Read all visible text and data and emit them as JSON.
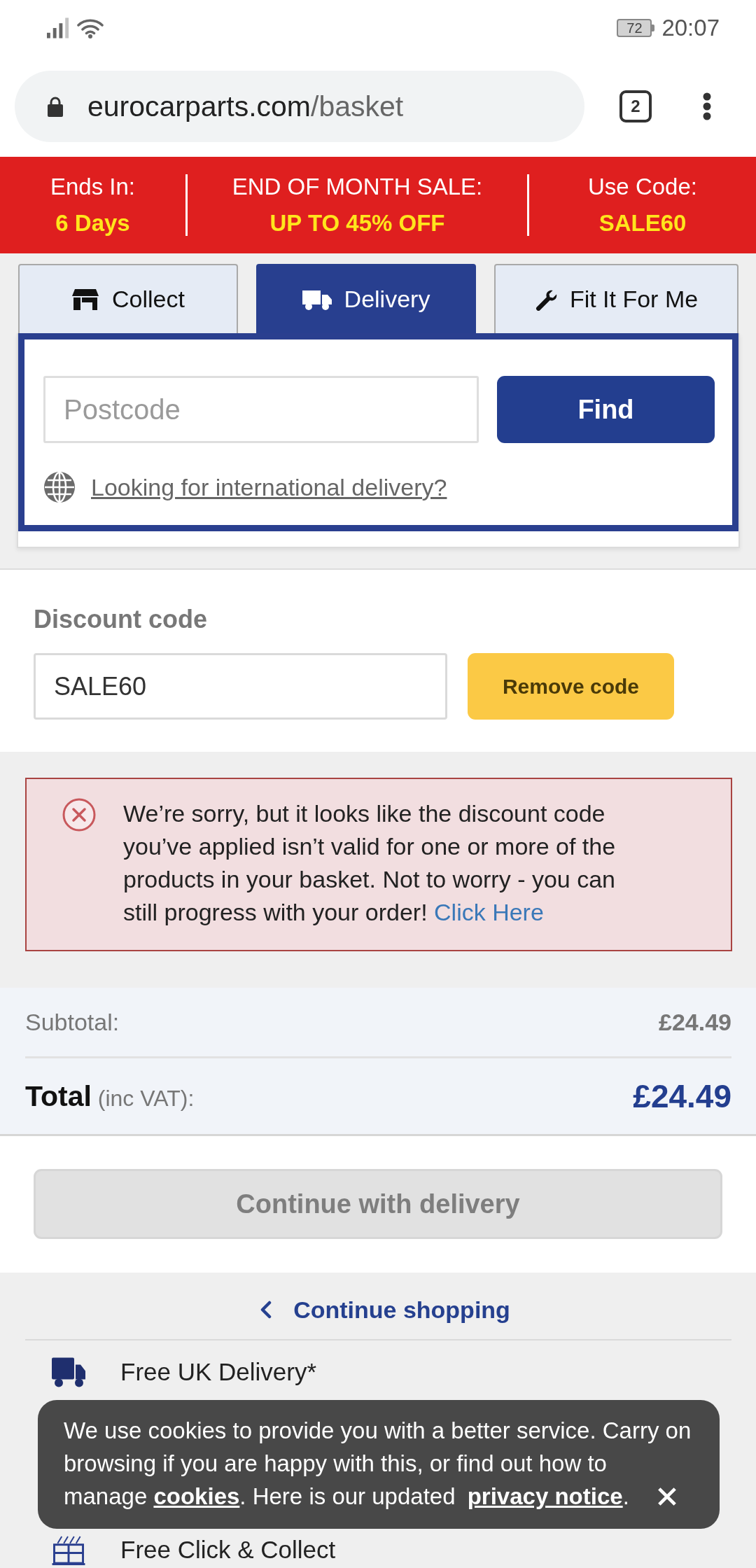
{
  "status_bar": {
    "battery": "72",
    "time": "20:07"
  },
  "address_bar": {
    "domain": "eurocarparts.com",
    "path": "/basket",
    "tab_count": "2"
  },
  "promo_banner": [
    {
      "label": "Ends In:",
      "value": "6 Days"
    },
    {
      "label": "END OF MONTH SALE:",
      "value": "UP TO 45% OFF"
    },
    {
      "label": "Use Code:",
      "value": "SALE60"
    }
  ],
  "delivery_tabs": [
    {
      "kind": "collect",
      "label": "Collect",
      "selected": false
    },
    {
      "kind": "delivery",
      "label": "Delivery",
      "selected": true
    },
    {
      "kind": "fitting",
      "label": "Fit It For Me",
      "selected": false
    }
  ],
  "postcode_search": {
    "placeholder": "Postcode",
    "button": "Find",
    "international_link": "Looking for international delivery?"
  },
  "discount": {
    "label": "Discount code",
    "value": "SALE60",
    "button": "Remove code"
  },
  "error_alert": {
    "message": "We’re sorry, but it looks like the discount code you’ve applied isn’t valid for one or more of the products in your basket. Not to worry - you can still progress with your order!",
    "link": "Click Here"
  },
  "totals": {
    "subtotal_label": "Subtotal:",
    "subtotal": "£24.49",
    "total_label": "**Total** (inc VAT):",
    "total": "£24.49"
  },
  "continue_button": {
    "label": "Continue with delivery",
    "disabled": true
  },
  "continue_shopping": "Continue shopping",
  "features": [
    {
      "kind": "delivery",
      "label": "Free UK Delivery*"
    },
    {
      "kind": "collect",
      "label": "Free Click & Collect"
    }
  ],
  "cookie_notice": {
    "text_before": "We use cookies to provide you with a better service. Carry on browsing if you are happy with this, or find out how to manage ",
    "cookies_link": "cookies",
    "text_middle": ". Here is our updated ",
    "privacy_link": "privacy notice",
    "text_after": "."
  }
}
